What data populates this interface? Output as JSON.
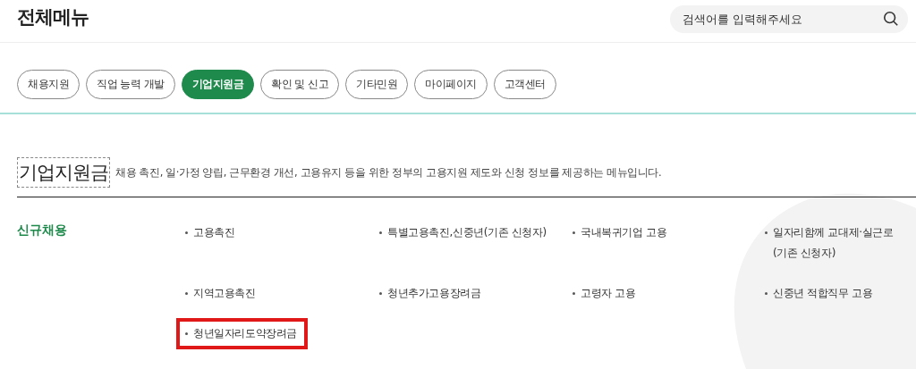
{
  "header": {
    "title": "전체메뉴",
    "search": {
      "placeholder": "검색어를 입력해주세요"
    }
  },
  "tabs": [
    {
      "label": "채용지원",
      "selected": false
    },
    {
      "label": "직업 능력 개발",
      "selected": false
    },
    {
      "label": "기업지원금",
      "selected": true
    },
    {
      "label": "확인 및 신고",
      "selected": false
    },
    {
      "label": "기타민원",
      "selected": false
    },
    {
      "label": "마이페이지",
      "selected": false
    },
    {
      "label": "고객센터",
      "selected": false
    }
  ],
  "section": {
    "title": "기업지원금",
    "description": "채용 촉진, 일·가정 양립, 근무환경 개선, 고용유지 등을 위한 정부의 고용지원 제도와 신청 정보를 제공하는 메뉴입니다."
  },
  "categories": [
    {
      "title": "신규채용",
      "items": [
        {
          "label": "고용촉진",
          "highlighted": false
        },
        {
          "label": "특별고용촉진,신중년(기존 신청자)",
          "highlighted": false
        },
        {
          "label": "국내복귀기업 고용",
          "highlighted": false
        },
        {
          "label": "일자리함께 교대제·실근로(기존 신청자)",
          "highlighted": false
        },
        {
          "label": "지역고용촉진",
          "highlighted": false
        },
        {
          "label": "청년추가고용장려금",
          "highlighted": false
        },
        {
          "label": "고령자 고용",
          "highlighted": false
        },
        {
          "label": "신중년 적합직무 고용",
          "highlighted": false
        },
        {
          "label": "청년일자리도약장려금",
          "highlighted": true
        }
      ]
    }
  ]
}
